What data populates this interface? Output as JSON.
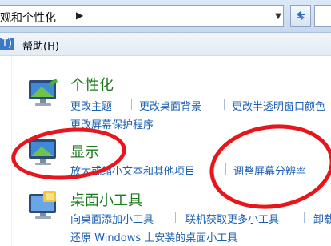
{
  "address": {
    "path": "观和个性化",
    "arrow": "▶"
  },
  "menu": {
    "fragment": "T)",
    "help": "帮助(H)"
  },
  "categories": {
    "personalization": {
      "title": "个性化",
      "links": [
        "更改主题",
        "更改桌面背景",
        "更改半透明窗口颜色",
        "更改屏幕保护程序"
      ]
    },
    "display": {
      "title": "显示",
      "links": [
        "放大或缩小文本和其他项目",
        "调整屏幕分辨率"
      ]
    },
    "gadgets": {
      "title": "桌面小工具",
      "links": [
        "向桌面添加小工具",
        "联机获取更多小工具",
        "卸载",
        "还原 Windows 上安装的桌面小工具"
      ]
    }
  },
  "colors": {
    "link": "#1a5fb4",
    "title": "#1e7a1e",
    "annotation": "#e8161b"
  }
}
